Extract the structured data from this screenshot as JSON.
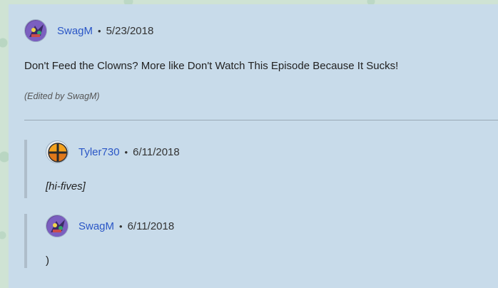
{
  "comments": [
    {
      "username": "SwagM",
      "separator": "•",
      "date": "5/23/2018",
      "text": "Don't Feed the Clowns? More like Don't Watch This Episode Because It Sucks!",
      "edited": "(Edited by SwagM)",
      "avatar_icon": "swagm-avatar-icon"
    }
  ],
  "replies": [
    {
      "username": "Tyler730",
      "separator": "•",
      "date": "6/11/2018",
      "text": "[hi-fives]",
      "avatar_icon": "smash-ball-avatar-icon"
    },
    {
      "username": "SwagM",
      "separator": "•",
      "date": "6/11/2018",
      "text": ")",
      "avatar_icon": "swagm-avatar-icon"
    }
  ],
  "colors": {
    "link": "#2a56c6",
    "panel": "#c8dbea",
    "background": "#cfe3d4"
  }
}
